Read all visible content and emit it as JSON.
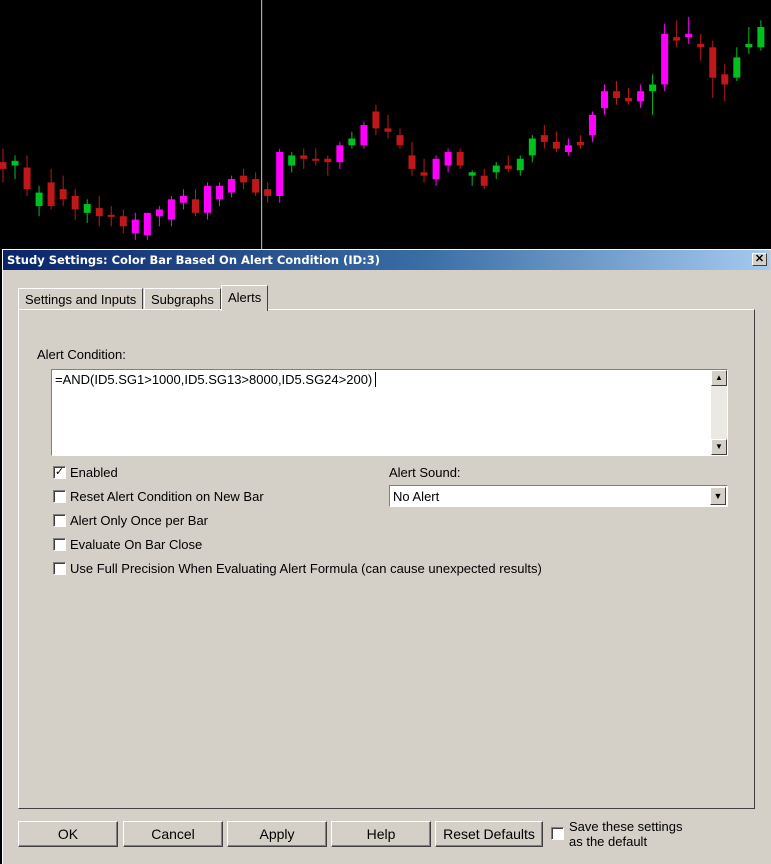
{
  "dialog": {
    "title": "Study Settings: Color Bar Based On Alert Condition (ID:3)",
    "close_glyph": "✕"
  },
  "tabs": [
    {
      "label": "Settings and Inputs",
      "active": false
    },
    {
      "label": "Subgraphs",
      "active": false
    },
    {
      "label": "Alerts",
      "active": true
    }
  ],
  "alerts": {
    "condition_label": "Alert Condition:",
    "condition_value": "=AND(ID5.SG1>1000,ID5.SG13>8000,ID5.SG24>200)",
    "scroll_up_glyph": "▲",
    "scroll_down_glyph": "▼",
    "options": [
      {
        "label": "Enabled",
        "checked": true
      },
      {
        "label": "Reset Alert Condition on New Bar",
        "checked": false
      },
      {
        "label": "Alert Only Once per Bar",
        "checked": false
      },
      {
        "label": "Evaluate On Bar Close",
        "checked": false
      },
      {
        "label": "Use Full Precision When Evaluating Alert Formula (can cause unexpected results)",
        "checked": false
      }
    ],
    "check_glyph": "✓",
    "sound_label": "Alert Sound:",
    "sound_value": "No Alert",
    "dropdown_glyph": "▼"
  },
  "buttons": {
    "ok": "OK",
    "cancel": "Cancel",
    "apply": "Apply",
    "help": "Help",
    "reset_defaults": "Reset Defaults"
  },
  "save_default": {
    "line1": "Save these settings",
    "line2": "as the default",
    "checked": false
  },
  "chart_colors": {
    "background": "#000000",
    "up": "#00c020",
    "down": "#c01818",
    "highlight": "#ff00ff",
    "wick": "#c8c8c8"
  },
  "chart_bars": [
    {
      "o": 3810,
      "h": 3840,
      "l": 3790,
      "c": 3820,
      "color": "down"
    },
    {
      "o": 3815,
      "h": 3830,
      "l": 3795,
      "c": 3822,
      "color": "up"
    },
    {
      "o": 3812,
      "h": 3830,
      "l": 3770,
      "c": 3780,
      "color": "down"
    },
    {
      "o": 3755,
      "h": 3785,
      "l": 3740,
      "c": 3775,
      "color": "up"
    },
    {
      "o": 3790,
      "h": 3810,
      "l": 3750,
      "c": 3755,
      "color": "down"
    },
    {
      "o": 3780,
      "h": 3800,
      "l": 3755,
      "c": 3765,
      "color": "down"
    },
    {
      "o": 3770,
      "h": 3780,
      "l": 3735,
      "c": 3750,
      "color": "down"
    },
    {
      "o": 3745,
      "h": 3765,
      "l": 3730,
      "c": 3758,
      "color": "up"
    },
    {
      "o": 3752,
      "h": 3770,
      "l": 3725,
      "c": 3740,
      "color": "down"
    },
    {
      "o": 3742,
      "h": 3755,
      "l": 3725,
      "c": 3740,
      "color": "down"
    },
    {
      "o": 3740,
      "h": 3750,
      "l": 3715,
      "c": 3725,
      "color": "down"
    },
    {
      "o": 3715,
      "h": 3745,
      "l": 3705,
      "c": 3735,
      "color": "highlight"
    },
    {
      "o": 3712,
      "h": 3745,
      "l": 3705,
      "c": 3745,
      "color": "highlight"
    },
    {
      "o": 3740,
      "h": 3755,
      "l": 3725,
      "c": 3750,
      "color": "highlight"
    },
    {
      "o": 3735,
      "h": 3770,
      "l": 3725,
      "c": 3765,
      "color": "highlight"
    },
    {
      "o": 3760,
      "h": 3780,
      "l": 3750,
      "c": 3770,
      "color": "highlight"
    },
    {
      "o": 3765,
      "h": 3780,
      "l": 3740,
      "c": 3745,
      "color": "down"
    },
    {
      "o": 3745,
      "h": 3790,
      "l": 3735,
      "c": 3785,
      "color": "highlight"
    },
    {
      "o": 3765,
      "h": 3790,
      "l": 3755,
      "c": 3785,
      "color": "highlight"
    },
    {
      "o": 3775,
      "h": 3800,
      "l": 3768,
      "c": 3795,
      "color": "highlight"
    },
    {
      "o": 3790,
      "h": 3810,
      "l": 3780,
      "c": 3800,
      "color": "down"
    },
    {
      "o": 3795,
      "h": 3805,
      "l": 3770,
      "c": 3775,
      "color": "down"
    },
    {
      "o": 3770,
      "h": 3790,
      "l": 3760,
      "c": 3780,
      "color": "down"
    },
    {
      "o": 3770,
      "h": 3840,
      "l": 3760,
      "c": 3835,
      "color": "highlight"
    },
    {
      "o": 3815,
      "h": 3835,
      "l": 3805,
      "c": 3830,
      "color": "up"
    },
    {
      "o": 3830,
      "h": 3840,
      "l": 3810,
      "c": 3825,
      "color": "down"
    },
    {
      "o": 3825,
      "h": 3840,
      "l": 3815,
      "c": 3822,
      "color": "down"
    },
    {
      "o": 3820,
      "h": 3830,
      "l": 3800,
      "c": 3825,
      "color": "down"
    },
    {
      "o": 3820,
      "h": 3850,
      "l": 3810,
      "c": 3845,
      "color": "highlight"
    },
    {
      "o": 3855,
      "h": 3865,
      "l": 3840,
      "c": 3845,
      "color": "up"
    },
    {
      "o": 3845,
      "h": 3880,
      "l": 3840,
      "c": 3875,
      "color": "highlight"
    },
    {
      "o": 3895,
      "h": 3905,
      "l": 3860,
      "c": 3870,
      "color": "down"
    },
    {
      "o": 3870,
      "h": 3890,
      "l": 3855,
      "c": 3865,
      "color": "down"
    },
    {
      "o": 3860,
      "h": 3870,
      "l": 3840,
      "c": 3845,
      "color": "down"
    },
    {
      "o": 3830,
      "h": 3850,
      "l": 3800,
      "c": 3810,
      "color": "down"
    },
    {
      "o": 3805,
      "h": 3825,
      "l": 3790,
      "c": 3800,
      "color": "down"
    },
    {
      "o": 3795,
      "h": 3830,
      "l": 3785,
      "c": 3825,
      "color": "highlight"
    },
    {
      "o": 3815,
      "h": 3840,
      "l": 3805,
      "c": 3835,
      "color": "highlight"
    },
    {
      "o": 3835,
      "h": 3840,
      "l": 3810,
      "c": 3815,
      "color": "down"
    },
    {
      "o": 3800,
      "h": 3808,
      "l": 3785,
      "c": 3805,
      "color": "up"
    },
    {
      "o": 3800,
      "h": 3810,
      "l": 3780,
      "c": 3785,
      "color": "down"
    },
    {
      "o": 3805,
      "h": 3820,
      "l": 3795,
      "c": 3815,
      "color": "up"
    },
    {
      "o": 3815,
      "h": 3830,
      "l": 3805,
      "c": 3810,
      "color": "down"
    },
    {
      "o": 3808,
      "h": 3830,
      "l": 3800,
      "c": 3825,
      "color": "up"
    },
    {
      "o": 3830,
      "h": 3860,
      "l": 3820,
      "c": 3855,
      "color": "up"
    },
    {
      "o": 3860,
      "h": 3875,
      "l": 3840,
      "c": 3850,
      "color": "down"
    },
    {
      "o": 3850,
      "h": 3865,
      "l": 3835,
      "c": 3840,
      "color": "down"
    },
    {
      "o": 3835,
      "h": 3855,
      "l": 3830,
      "c": 3845,
      "color": "highlight"
    },
    {
      "o": 3850,
      "h": 3860,
      "l": 3840,
      "c": 3845,
      "color": "down"
    },
    {
      "o": 3860,
      "h": 3895,
      "l": 3850,
      "c": 3890,
      "color": "highlight"
    },
    {
      "o": 3900,
      "h": 3935,
      "l": 3890,
      "c": 3925,
      "color": "highlight"
    },
    {
      "o": 3925,
      "h": 3940,
      "l": 3905,
      "c": 3915,
      "color": "down"
    },
    {
      "o": 3915,
      "h": 3930,
      "l": 3905,
      "c": 3910,
      "color": "down"
    },
    {
      "o": 3910,
      "h": 3935,
      "l": 3900,
      "c": 3925,
      "color": "highlight"
    },
    {
      "o": 3925,
      "h": 3950,
      "l": 3890,
      "c": 3935,
      "color": "up"
    },
    {
      "o": 3935,
      "h": 4025,
      "l": 3925,
      "c": 4010,
      "color": "highlight"
    },
    {
      "o": 4005,
      "h": 4030,
      "l": 3990,
      "c": 4000,
      "color": "down"
    },
    {
      "o": 4010,
      "h": 4035,
      "l": 3995,
      "c": 4005,
      "color": "highlight"
    },
    {
      "o": 3995,
      "h": 4010,
      "l": 3970,
      "c": 3990,
      "color": "down"
    },
    {
      "o": 3990,
      "h": 4000,
      "l": 3915,
      "c": 3945,
      "color": "down"
    },
    {
      "o": 3950,
      "h": 3965,
      "l": 3910,
      "c": 3935,
      "color": "down"
    },
    {
      "o": 3945,
      "h": 3990,
      "l": 3940,
      "c": 3975,
      "color": "up"
    },
    {
      "o": 3990,
      "h": 4020,
      "l": 3980,
      "c": 3995,
      "color": "up"
    },
    {
      "o": 3990,
      "h": 4030,
      "l": 3985,
      "c": 4020,
      "color": "up"
    }
  ],
  "chart_price_range": [
    3690,
    4060
  ],
  "chart_cursor_bar_index": 22
}
